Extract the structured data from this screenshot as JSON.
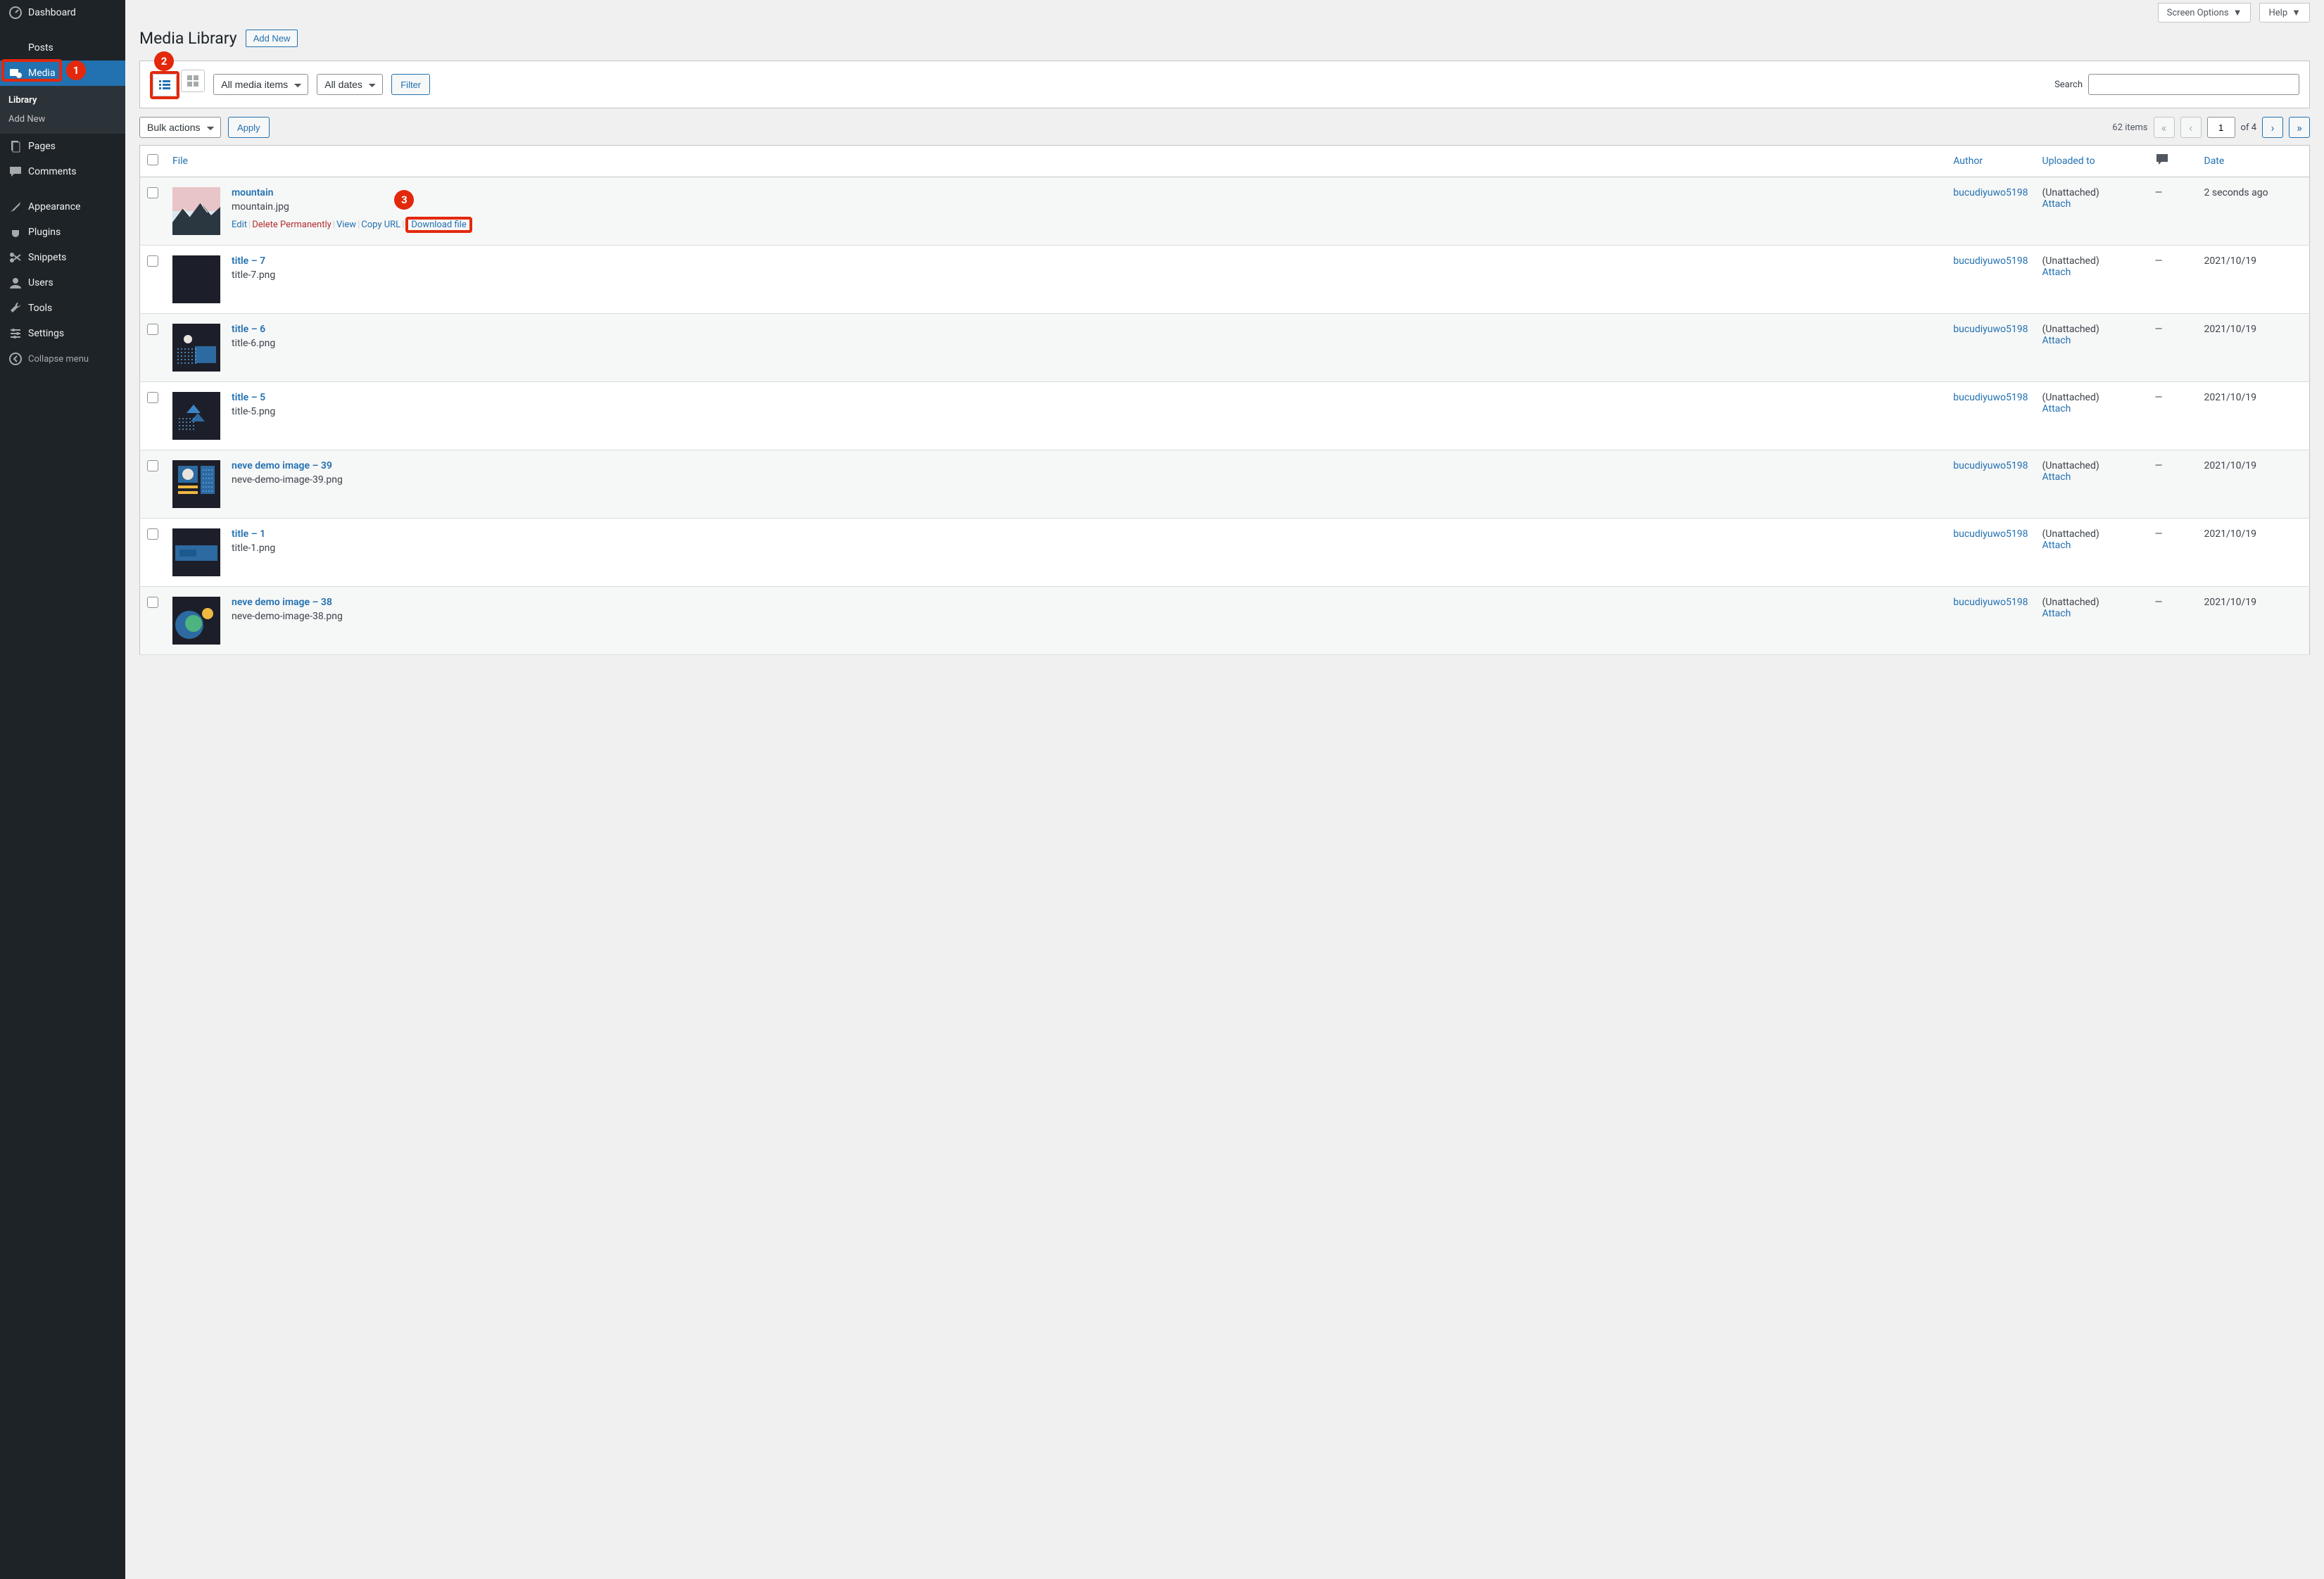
{
  "sidebar": {
    "dashboard": "Dashboard",
    "posts": "Posts",
    "media": "Media",
    "library": "Library",
    "add_new": "Add New",
    "pages": "Pages",
    "comments": "Comments",
    "appearance": "Appearance",
    "plugins": "Plugins",
    "snippets": "Snippets",
    "users": "Users",
    "tools": "Tools",
    "settings": "Settings",
    "collapse": "Collapse menu"
  },
  "top": {
    "screen_options": "Screen Options",
    "help": "Help"
  },
  "page": {
    "title": "Media Library",
    "add_new": "Add New"
  },
  "filters": {
    "media_items": "All media items",
    "dates": "All dates",
    "filter": "Filter",
    "search_label": "Search"
  },
  "bulk": {
    "actions": "Bulk actions",
    "apply": "Apply",
    "items_count": "62 items",
    "page": "1",
    "of": "of 4"
  },
  "columns": {
    "file": "File",
    "author": "Author",
    "uploaded": "Uploaded to",
    "date": "Date"
  },
  "common": {
    "author": "bucudiyuwo5198",
    "unattached": "(Unattached)",
    "attach": "Attach",
    "mdash": "—"
  },
  "actions": {
    "edit": "Edit",
    "delete": "Delete Permanently",
    "view": "View",
    "copy": "Copy URL",
    "download": "Download file"
  },
  "rows": [
    {
      "title": "mountain",
      "file": "mountain.jpg",
      "date": "2 seconds ago",
      "show_actions": true,
      "thumb": "mountain"
    },
    {
      "title": "title – 7",
      "file": "title-7.png",
      "date": "2021/10/19",
      "thumb": "dark"
    },
    {
      "title": "title – 6",
      "file": "title-6.png",
      "date": "2021/10/19",
      "thumb": "dots"
    },
    {
      "title": "title – 5",
      "file": "title-5.png",
      "date": "2021/10/19",
      "thumb": "arrows"
    },
    {
      "title": "neve demo image – 39",
      "file": "neve-demo-image-39.png",
      "date": "2021/10/19",
      "thumb": "sun"
    },
    {
      "title": "title – 1",
      "file": "title-1.png",
      "date": "2021/10/19",
      "thumb": "blue"
    },
    {
      "title": "neve demo image – 38",
      "file": "neve-demo-image-38.png",
      "date": "2021/10/19",
      "thumb": "circles"
    }
  ],
  "callouts": {
    "one": "1",
    "two": "2",
    "three": "3"
  }
}
